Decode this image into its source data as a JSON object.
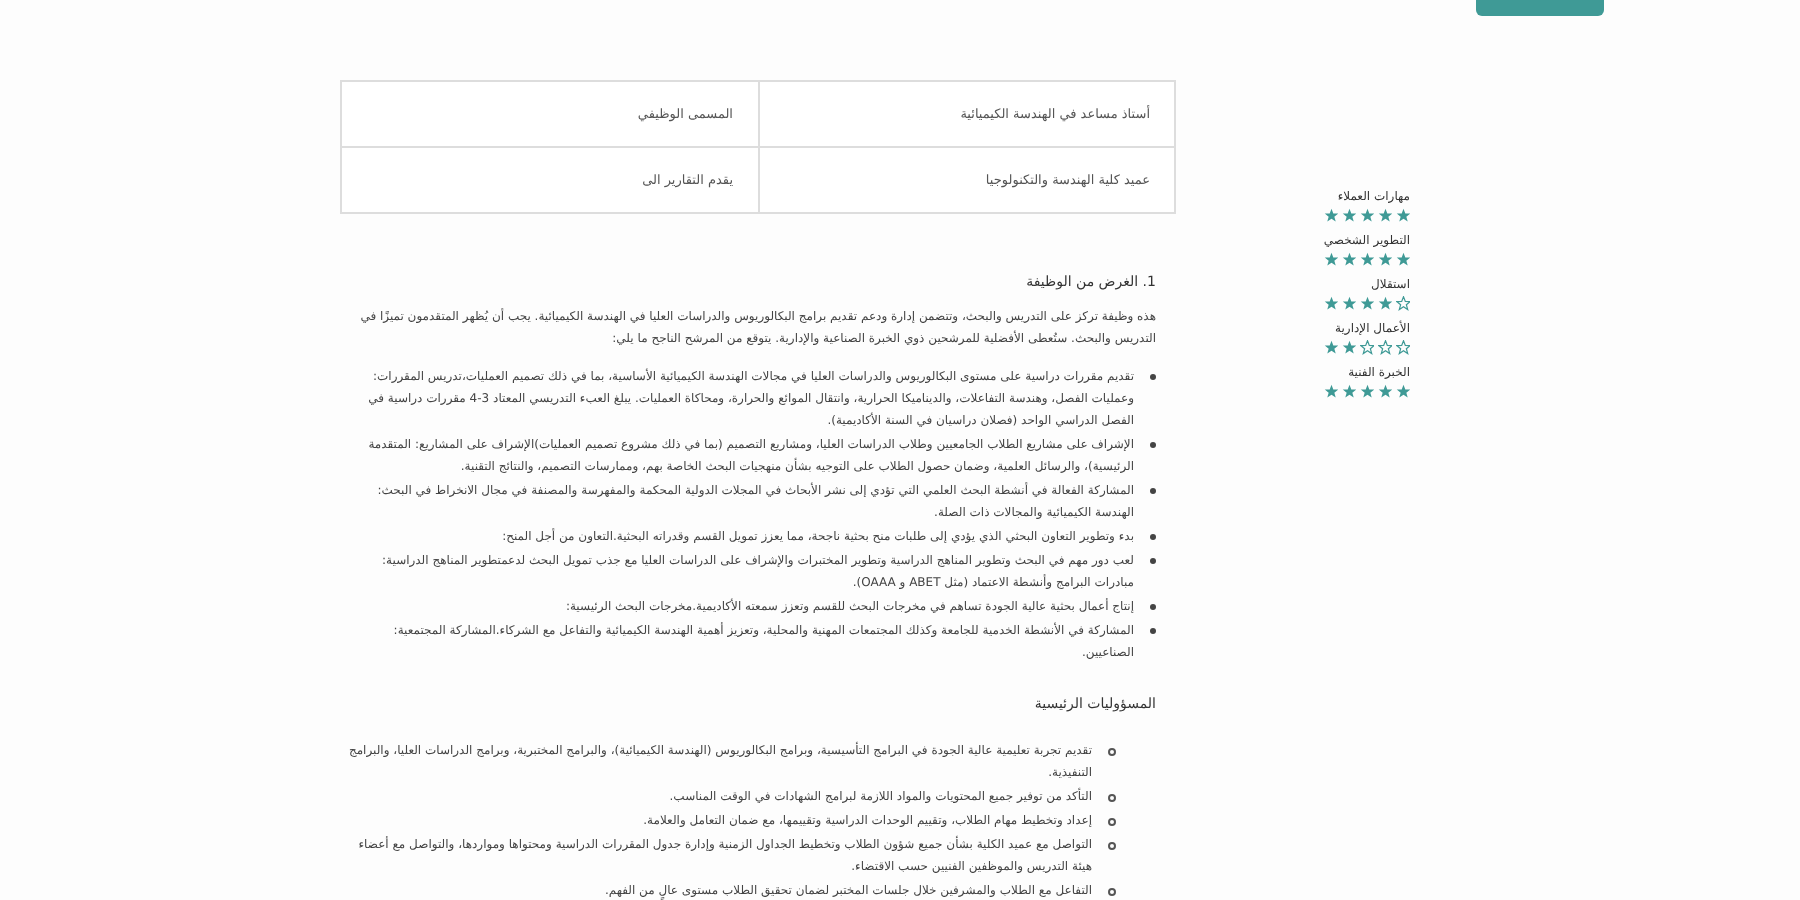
{
  "info_table": {
    "rows": [
      {
        "label": "المسمى الوظيفي",
        "value": "أستاذ مساعد في الهندسة الكيميائية"
      },
      {
        "label": "يقدم التقارير الى",
        "value": "عميد كلية الهندسة والتكنولوجيا"
      }
    ]
  },
  "ratings": [
    {
      "label": "مهارات العملاء",
      "stars": 5
    },
    {
      "label": "التطوير الشخصي",
      "stars": 5
    },
    {
      "label": "استقلال",
      "stars": 4
    },
    {
      "label": "الأعمال الإدارية",
      "stars": 2
    },
    {
      "label": "الخبرة الفنية",
      "stars": 5
    }
  ],
  "sections": [
    {
      "heading": "1. الغرض من الوظيفة",
      "intro": "هذه وظيفة تركز على التدريس والبحث، وتتضمن إدارة ودعم تقديم برامج البكالوريوس والدراسات العليا في الهندسة الكيميائية. يجب أن يُظهر المتقدمون تميزًا في التدريس والبحث. ستُعطى الأفضلية للمرشحين ذوي الخبرة الصناعية والإدارية. يتوقع من المرشح الناجح ما يلي:",
      "kind": "disc",
      "items": [
        "تقديم مقررات دراسية على مستوى البكالوريوس والدراسات العليا في مجالات الهندسة الكيميائية الأساسية، بما في ذلك تصميم العمليات،تدريس المقررات: وعمليات الفصل، وهندسة التفاعلات، والديناميكا الحرارية، وانتقال الموائع والحرارة، ومحاكاة العمليات. يبلغ العبء التدريسي المعتاد 3-4 مقررات دراسية في الفصل الدراسي الواحد (فصلان دراسيان في السنة الأكاديمية).",
        "الإشراف على مشاريع الطلاب الجامعيين وطلاب الدراسات العليا، ومشاريع التصميم (بما في ذلك مشروع تصميم العمليات)الإشراف على المشاريع: المتقدمة الرئيسية)، والرسائل العلمية، وضمان حصول الطلاب على التوجيه بشأن منهجيات البحث الخاصة بهم، وممارسات التصميم، والنتائج التقنية.",
        "المشاركة الفعالة في أنشطة البحث العلمي التي تؤدي إلى نشر الأبحاث في المجلات الدولية المحكمة والمفهرسة والمصنفة في مجال الانخراط في البحث: الهندسة الكيميائية والمجالات ذات الصلة.",
        "بدء وتطوير التعاون البحثي الذي يؤدي إلى طلبات منح بحثية ناجحة، مما يعزز تمويل القسم وقدراته البحثية.التعاون من أجل المنح:",
        "لعب دور مهم في البحث وتطوير المناهج الدراسية وتطوير المختبرات والإشراف على الدراسات العليا مع جذب تمويل البحث لدعمتطوير المناهج الدراسية: مبادرات البرامج وأنشطة الاعتماد (مثل ABET و OAAA).",
        "إنتاج أعمال بحثية عالية الجودة تساهم في مخرجات البحث للقسم وتعزز سمعته الأكاديمية.مخرجات البحث الرئيسية:",
        "المشاركة في الأنشطة الخدمية للجامعة وكذلك المجتمعات المهنية والمحلية، وتعزيز أهمية الهندسة الكيميائية والتفاعل مع الشركاء.المشاركة المجتمعية: الصناعيين."
      ]
    },
    {
      "heading": "المسؤوليات الرئيسية",
      "kind": "circle",
      "items": [
        "تقديم تجربة تعليمية عالية الجودة في البرامج التأسيسية، وبرامج البكالوريوس (الهندسة الكيميائية)، والبرامج المختبرية، وبرامج الدراسات العليا، والبرامج التنفيذية.",
        "التأكد من توفير جميع المحتويات والمواد اللازمة لبرامج الشهادات في الوقت المناسب.",
        "إعداد وتخطيط مهام الطلاب، وتقييم الوحدات الدراسية وتقييمها، مع ضمان التعامل والعلامة.",
        "التواصل مع عميد الكلية بشأن جميع شؤون الطلاب وتخطيط الجداول الزمنية وإدارة جدول المقررات الدراسية ومحتواها ومواردها، والتواصل مع أعضاء هيئة التدريس والموظفين الفنيين حسب الاقتضاء.",
        "التفاعل مع الطلاب والمشرفين خلال جلسات المختبر لضمان تحقيق الطلاب مستوى عالٍ من الفهم."
      ]
    }
  ]
}
